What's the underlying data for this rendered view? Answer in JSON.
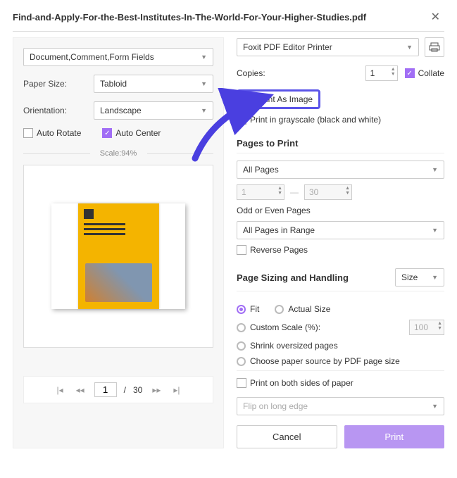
{
  "header": {
    "title": "Find-and-Apply-For-the-Best-Institutes-In-The-World-For-Your-Higher-Studies.pdf"
  },
  "left": {
    "fields_dropdown": "Document,Comment,Form Fields",
    "paper_label": "Paper Size:",
    "paper_value": "Tabloid",
    "orient_label": "Orientation:",
    "orient_value": "Landscape",
    "auto_rotate": "Auto Rotate",
    "auto_center": "Auto Center",
    "scale": "Scale:94%",
    "pager": {
      "current": "1",
      "sep": "/",
      "total": "30"
    }
  },
  "right": {
    "printer": "Foxit PDF Editor Printer",
    "copies_label": "Copies:",
    "copies_value": "1",
    "collate": "Collate",
    "print_as_image": "Print As Image",
    "grayscale": "Print in grayscale (black and white)",
    "pages_heading": "Pages to Print",
    "pages_dropdown": "All Pages",
    "range_from": "1",
    "range_to": "30",
    "odd_label": "Odd or Even Pages",
    "odd_value": "All Pages in Range",
    "reverse": "Reverse Pages",
    "sizing_heading": "Page Sizing and Handling",
    "size_dropdown": "Size",
    "fit": "Fit",
    "actual": "Actual Size",
    "custom_scale": "Custom Scale (%):",
    "custom_value": "100",
    "shrink": "Shrink oversized pages",
    "choose_source": "Choose paper source by PDF page size",
    "both_sides": "Print on both sides of paper",
    "flip": "Flip on long edge",
    "cancel": "Cancel",
    "print": "Print"
  }
}
